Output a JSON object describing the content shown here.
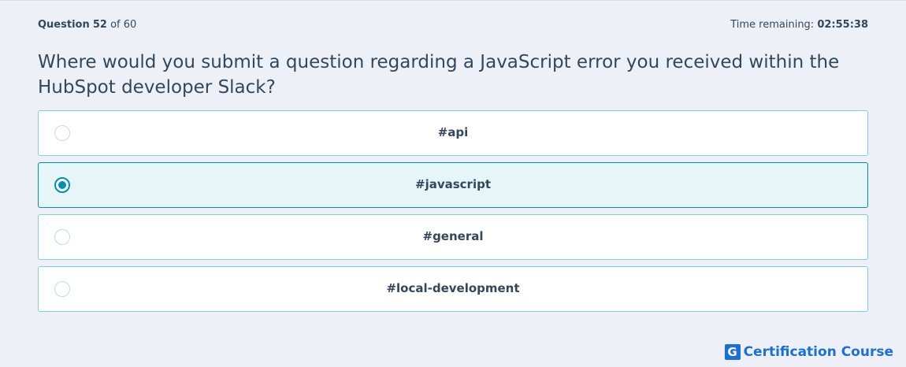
{
  "header": {
    "question_label": "Question",
    "question_number": "52",
    "of_total": "of 60",
    "time_label": "Time remaining:",
    "time_value": "02:55:38"
  },
  "question": {
    "text": "Where would you submit a question regarding a JavaScript error you received within the HubSpot developer Slack?"
  },
  "options": [
    {
      "label": "#api",
      "selected": false
    },
    {
      "label": "#javascript",
      "selected": true
    },
    {
      "label": "#general",
      "selected": false
    },
    {
      "label": "#local-development",
      "selected": false
    }
  ],
  "brand": {
    "icon_letter": "G",
    "text": "Certification Course"
  },
  "colors": {
    "accent": "#0091ae",
    "brand": "#1a6fd8",
    "text": "#33475b",
    "background": "#edf1f7"
  }
}
